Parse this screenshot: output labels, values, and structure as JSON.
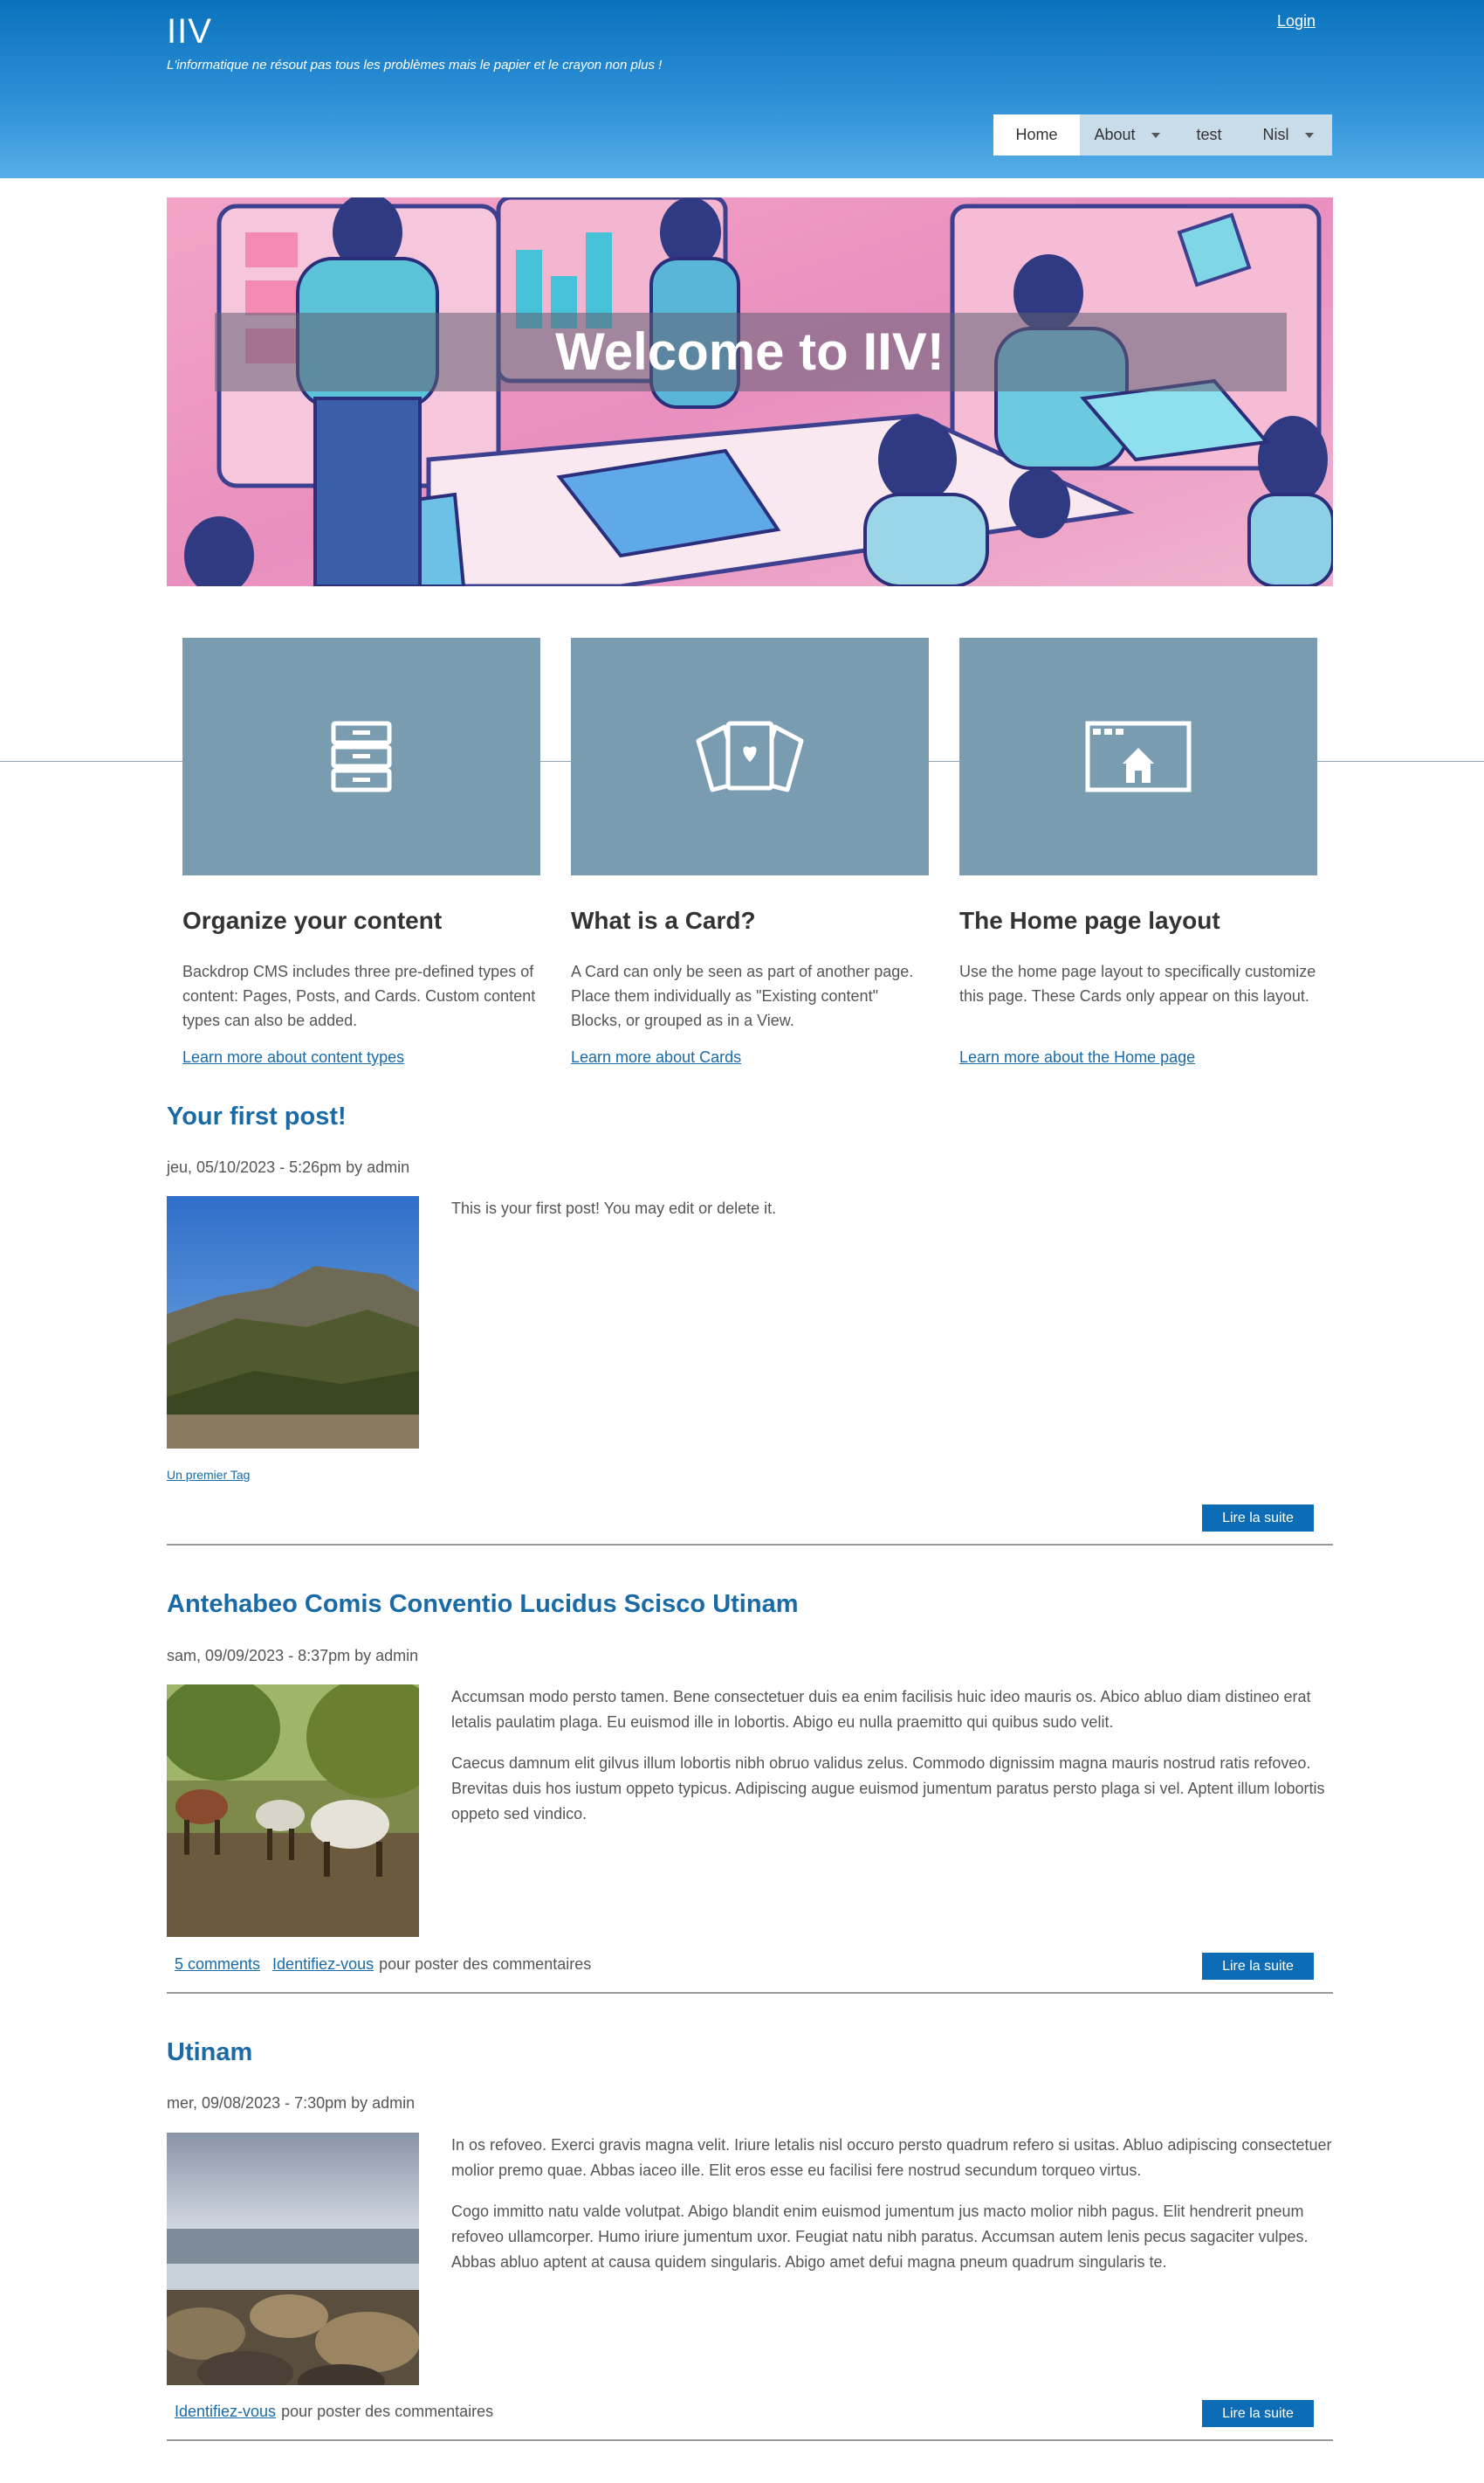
{
  "header": {
    "site_name": "IIV",
    "slogan": "L'informatique ne résout pas tous les problèmes mais le papier et le crayon non plus !",
    "login": "Login",
    "menu": [
      {
        "label": "Home",
        "active": true
      },
      {
        "label": "About",
        "dropdown": true
      },
      {
        "label": "test"
      },
      {
        "label": "Nisl",
        "dropdown": true
      }
    ]
  },
  "hero": {
    "title": "Welcome to IIV!"
  },
  "cards": [
    {
      "icon": "drawers-icon",
      "title": "Organize your content",
      "text": "Backdrop CMS includes three pre-defined types of content: Pages, Posts, and Cards. Custom content types can also be added.",
      "link": "Learn more about content types"
    },
    {
      "icon": "cards-icon",
      "title": "What is a Card?",
      "text": "A Card can only be seen as part of another page. Place them individually as \"Existing content\" Blocks, or grouped as in a View.",
      "link": "Learn more about Cards"
    },
    {
      "icon": "home-window-icon",
      "title": "The Home page layout",
      "text": "Use the home page layout to specifically customize this page. These Cards only appear on this layout.",
      "link": "Learn more about the Home page"
    }
  ],
  "posts": [
    {
      "title": "Your first post!",
      "meta": "jeu, 05/10/2023 - 5:26pm by admin",
      "body": [
        "This is your first post! You may edit or delete it."
      ],
      "tag": "Un premier Tag",
      "read_more": "Lire la suite"
    },
    {
      "title": "Antehabeo Comis Conventio Lucidus Scisco Utinam",
      "meta": "sam, 09/09/2023 - 8:37pm by admin",
      "body": [
        "Accumsan modo persto tamen. Bene consectetuer duis ea enim facilisis huic ideo mauris os. Abico abluo diam distineo erat letalis paulatim plaga. Eu euismod ille in lobortis. Abigo eu nulla praemitto qui quibus sudo velit.",
        "Caecus damnum elit gilvus illum lobortis nibh obruo validus zelus. Commodo dignissim magna mauris nostrud ratis refoveo. Brevitas duis hos iustum oppeto typicus. Adipiscing augue euismod jumentum paratus persto plaga si vel. Aptent illum lobortis oppeto sed vindico."
      ],
      "comments": "5 comments",
      "login_link": "Identifiez-vous",
      "login_text": "pour poster des commentaires",
      "read_more": "Lire la suite"
    },
    {
      "title": "Utinam",
      "meta": "mer, 09/08/2023 - 7:30pm by admin",
      "body": [
        "In os refoveo. Exerci gravis magna velit. Iriure letalis nisl occuro persto quadrum refero si usitas. Abluo adipiscing consectetuer molior premo quae. Abbas iaceo ille. Elit eros esse eu facilisi fere nostrud secundum torqueo virtus.",
        "Cogo immitto natu valde volutpat. Abigo blandit enim euismod jumentum jus macto molior nibh pagus. Elit hendrerit pneum refoveo ullamcorper. Humo iriure jumentum uxor. Feugiat natu nibh paratus. Accumsan autem lenis pecus sagaciter vulpes. Abbas abluo aptent at causa quidem singularis. Abigo amet defui magna pneum quadrum singularis te."
      ],
      "login_link": "Identifiez-vous",
      "login_text": "pour poster des commentaires",
      "read_more": "Lire la suite"
    }
  ]
}
